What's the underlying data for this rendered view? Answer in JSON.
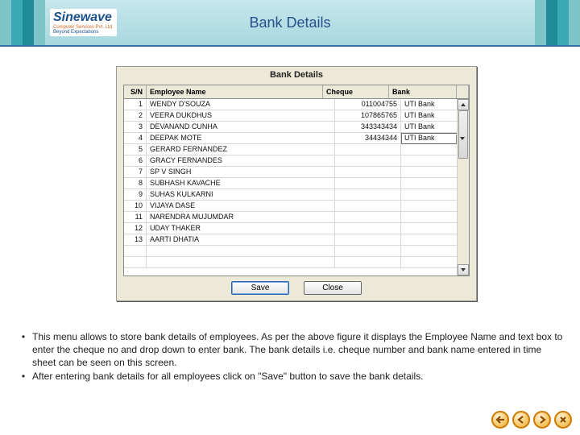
{
  "logo": {
    "brand": "Sinewave",
    "sub": "Computer Services Pvt. Ltd.",
    "tag": "Beyond Expectations"
  },
  "page_title": "Bank Details",
  "dialog": {
    "title": "Bank Details",
    "columns": {
      "sn": "S/N",
      "name": "Employee Name",
      "cheque": "Cheque",
      "bank": "Bank"
    },
    "rows": [
      {
        "sn": "1",
        "name": "WENDY D'SOUZA",
        "cheque": "011004755",
        "bank": "UTI Bank"
      },
      {
        "sn": "2",
        "name": "VEERA DUKDHUS",
        "cheque": "107865765",
        "bank": "UTI Bank"
      },
      {
        "sn": "3",
        "name": "DEVANAND CUNHA",
        "cheque": "343343434",
        "bank": "UTI Bank"
      },
      {
        "sn": "4",
        "name": "DEEPAK MOTE",
        "cheque": "34434344",
        "bank": "UTI Bank"
      },
      {
        "sn": "5",
        "name": "GERARD FERNANDEZ",
        "cheque": "",
        "bank": ""
      },
      {
        "sn": "6",
        "name": "GRACY FERNANDES",
        "cheque": "",
        "bank": ""
      },
      {
        "sn": "7",
        "name": "SP V SINGH",
        "cheque": "",
        "bank": ""
      },
      {
        "sn": "8",
        "name": "SUBHASH KAVACHE",
        "cheque": "",
        "bank": ""
      },
      {
        "sn": "9",
        "name": "SUHAS KULKARNI",
        "cheque": "",
        "bank": ""
      },
      {
        "sn": "10",
        "name": "VIJAYA DASE",
        "cheque": "",
        "bank": ""
      },
      {
        "sn": "11",
        "name": "NARENDRA MUJUMDAR",
        "cheque": "",
        "bank": ""
      },
      {
        "sn": "12",
        "name": "UDAY THAKER",
        "cheque": "",
        "bank": ""
      },
      {
        "sn": "13",
        "name": "AARTI DHATIA",
        "cheque": "",
        "bank": ""
      }
    ],
    "active_row_index": 3,
    "buttons": {
      "save": "Save",
      "close": "Close"
    }
  },
  "notes": {
    "p1": "This menu allows to store bank details of employees. As per the above figure it displays the Employee Name and text box to enter the cheque no and drop down to enter bank. The bank details i.e. cheque number and bank name entered in time sheet can be seen on this screen.",
    "p2": "After entering bank details for all employees click on \"Save\" button to save the bank details."
  }
}
